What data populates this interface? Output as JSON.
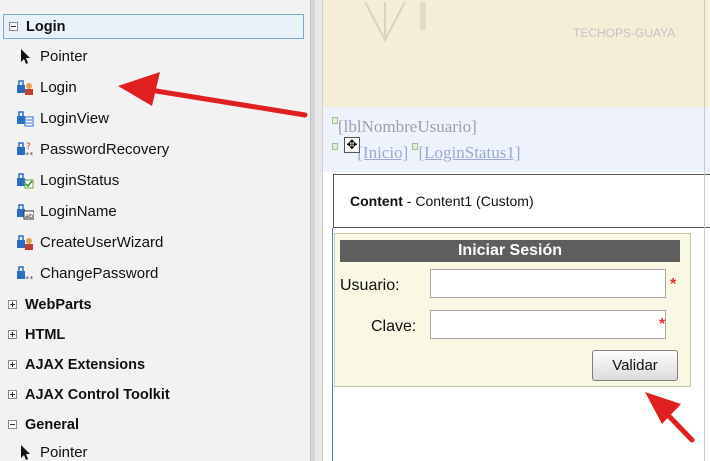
{
  "toolbox": {
    "groups": [
      {
        "label": "Login",
        "expanded": true,
        "selected": true
      },
      {
        "label": "WebParts",
        "expanded": false
      },
      {
        "label": "HTML",
        "expanded": false
      },
      {
        "label": "AJAX Extensions",
        "expanded": false
      },
      {
        "label": "AJAX Control Toolkit",
        "expanded": false
      },
      {
        "label": "General",
        "expanded": true
      }
    ],
    "login_items": [
      {
        "label": "Pointer",
        "icon": "pointer-icon"
      },
      {
        "label": "Login",
        "icon": "login-control-icon"
      },
      {
        "label": "LoginView",
        "icon": "loginview-icon"
      },
      {
        "label": "PasswordRecovery",
        "icon": "password-recovery-icon"
      },
      {
        "label": "LoginStatus",
        "icon": "loginstatus-icon"
      },
      {
        "label": "LoginName",
        "icon": "loginname-icon"
      },
      {
        "label": "CreateUserWizard",
        "icon": "create-user-wizard-icon"
      },
      {
        "label": "ChangePassword",
        "icon": "change-password-icon"
      }
    ],
    "general_items": [
      {
        "label": "Pointer",
        "icon": "pointer-icon"
      }
    ]
  },
  "designer": {
    "banner_text": "TECHOPS-GUAYA",
    "user_label": "[lblNombreUsuario]",
    "link_inicio": "[Inicio]",
    "link_login_status": "[LoginStatus1]",
    "content_name": "Content",
    "content_detail": " - Content1 (Custom)",
    "login": {
      "title": "Iniciar Sesión",
      "user_label": "Usuario:",
      "password_label": "Clave:",
      "required_mark": "*",
      "submit_label": "Validar",
      "user_value": "",
      "password_value": ""
    }
  },
  "colors": {
    "arrow": "#e02020",
    "selection_border": "#7aa7d9",
    "banner_bg": "#f5edd6",
    "login_title_bg": "#5e5e5e"
  }
}
